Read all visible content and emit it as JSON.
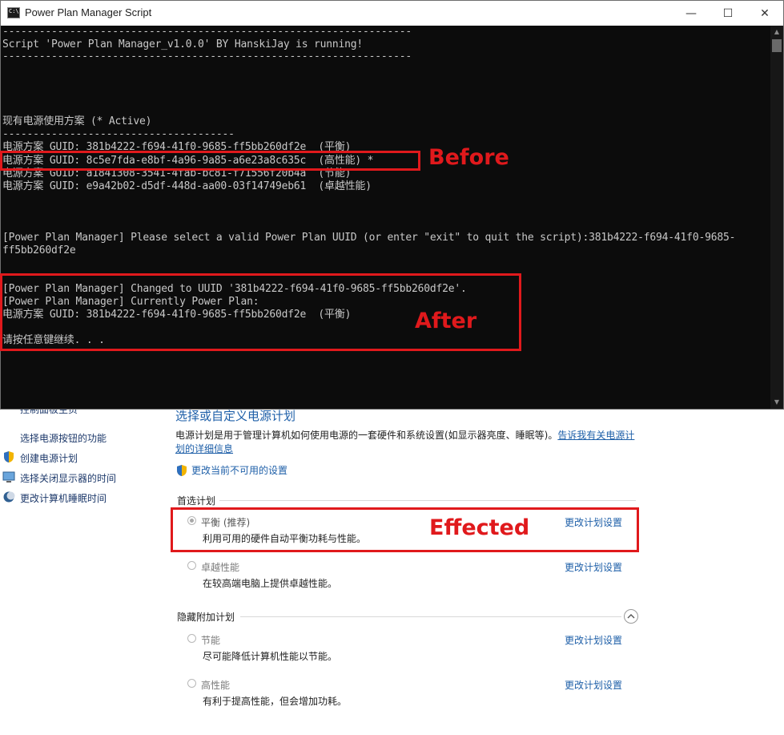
{
  "console": {
    "title": "Power Plan Manager Script",
    "buttons": {
      "minimize": "—",
      "maximize": "☐",
      "close": "✕"
    },
    "lines": [
      "-------------------------------------------------------------------",
      "Script 'Power Plan Manager_v1.0.0' BY HanskiJay is running!",
      "-------------------------------------------------------------------",
      "现有电源使用方案 (* Active)",
      "--------------------------------------",
      "电源方案 GUID: 381b4222-f694-41f0-9685-ff5bb260df2e  (平衡)",
      "电源方案 GUID: 8c5e7fda-e8bf-4a96-9a85-a6e23a8c635c  (高性能) *",
      "电源方案 GUID: a1841308-3541-4fab-bc81-f71556f20b4a  (节能)",
      "电源方案 GUID: e9a42b02-d5df-448d-aa00-03f14749eb61  (卓越性能)",
      "[Power Plan Manager] Please select a valid Power Plan UUID (or enter \"exit\" to quit the script):381b4222-f694-41f0-9685-",
      "ff5bb260df2e",
      "[Power Plan Manager] Changed to UUID '381b4222-f694-41f0-9685-ff5bb260df2e'.",
      "[Power Plan Manager] Currently Power Plan:",
      "电源方案 GUID: 381b4222-f694-41f0-9685-ff5bb260df2e  (平衡)",
      "请按任意键继续. . ."
    ]
  },
  "annotations": {
    "before": "Before",
    "after": "After",
    "effected": "Effected"
  },
  "control_panel": {
    "left_links": [
      "控制面板主页",
      "选择电源按钮的功能",
      "创建电源计划",
      "选择关闭显示器的时间",
      "更改计算机睡眠时间"
    ],
    "main_title": "选择或自定义电源计划",
    "description": "电源计划是用于管理计算机如何使用电源的一套硬件和系统设置(如显示器亮度、睡眠等)。",
    "description_link": "告诉我有关电源计划的详细信息",
    "unavailable_link": "更改当前不可用的设置",
    "preferred_group": "首选计划",
    "hidden_group": "隐藏附加计划",
    "change_label": "更改计划设置",
    "plans": [
      {
        "name": "平衡 (推荐)",
        "desc": "利用可用的硬件自动平衡功耗与性能。",
        "selected": true
      },
      {
        "name": "卓越性能",
        "desc": "在较高端电脑上提供卓越性能。",
        "selected": false
      },
      {
        "name": "节能",
        "desc": "尽可能降低计算机性能以节能。",
        "selected": false
      },
      {
        "name": "高性能",
        "desc": "有利于提高性能，但会增加功耗。",
        "selected": false
      }
    ]
  },
  "colors": {
    "accent_red": "#e0191c",
    "link_blue": "#1e5fa8",
    "console_bg": "#0c0c0c"
  }
}
